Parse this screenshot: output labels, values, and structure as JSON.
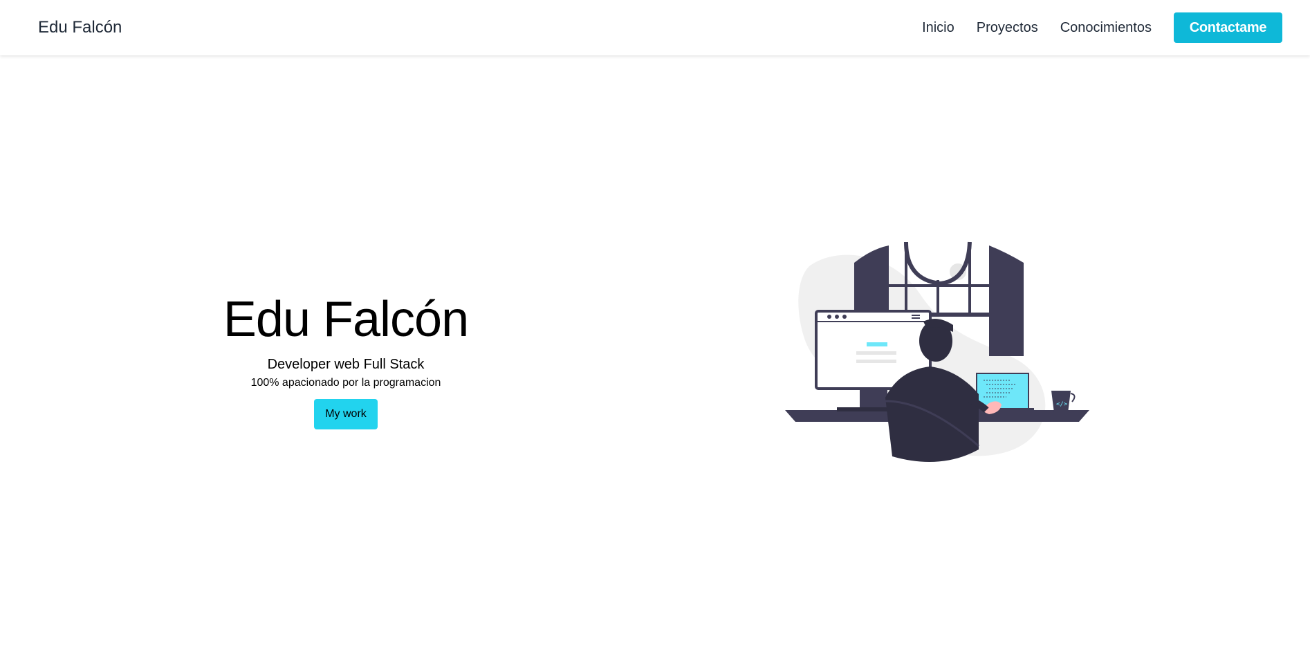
{
  "navbar": {
    "brand": "Edu Falcón",
    "links": [
      "Inicio",
      "Proyectos",
      "Conocimientos"
    ],
    "contact_label": "Contactame"
  },
  "hero": {
    "title": "Edu Falcón",
    "subtitle": "Developer web Full Stack",
    "tagline": "100% apacionado por la programacion",
    "cta_label": "My work"
  },
  "colors": {
    "accent": "#0eb8d8",
    "cta": "#22d3ee",
    "illustration_dark": "#3f3d56",
    "illustration_screen": "#6ee7f9"
  },
  "illustration": {
    "icon": "developer-at-desk-illustration"
  }
}
